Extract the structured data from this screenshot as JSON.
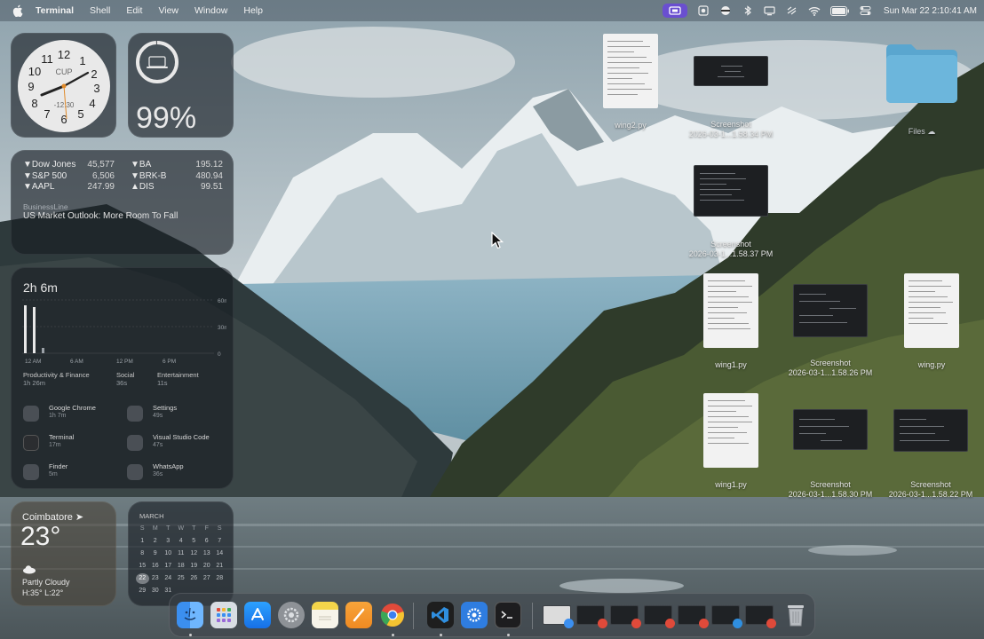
{
  "menubar": {
    "app_name": "Terminal",
    "menus": [
      "Shell",
      "Edit",
      "View",
      "Window",
      "Help"
    ],
    "clock": "Sun Mar 22  2:10:41 AM",
    "icons": [
      "screen-sharing-icon",
      "record-icon",
      "vpn-icon",
      "bluetooth-icon",
      "display-icon",
      "airplay-icon",
      "wifi-icon",
      "battery-icon",
      "control-center-icon"
    ]
  },
  "clock_widget": {
    "label": "CUP",
    "time_text": "-12:30",
    "numbers": [
      "12",
      "1",
      "2",
      "3",
      "4",
      "5",
      "6",
      "7",
      "8",
      "9",
      "10",
      "11"
    ]
  },
  "battery_widget": {
    "percent": "99%",
    "level": 0.99
  },
  "stocks": {
    "left": [
      {
        "name": "▼Dow Jones",
        "value": "45,577"
      },
      {
        "name": "▼S&P 500",
        "value": "6,506"
      },
      {
        "name": "▼AAPL",
        "value": "247.99"
      }
    ],
    "right": [
      {
        "name": "▼BA",
        "value": "195.12"
      },
      {
        "name": "▼BRK-B",
        "value": "480.94"
      },
      {
        "name": "▲DIS",
        "value": "99.51"
      }
    ],
    "source": "BusinessLine",
    "headline": "US Market Outlook: More Room To Fall"
  },
  "screen_time": {
    "total": "2h 6m",
    "y_labels": [
      "60m",
      "30m",
      "0"
    ],
    "x_labels": [
      "12 AM",
      "6 AM",
      "12 PM",
      "6 PM"
    ],
    "bars_minutes": [
      54,
      52,
      6
    ],
    "categories": [
      {
        "name": "Productivity & Finance",
        "time": "1h 26m"
      },
      {
        "name": "Social",
        "time": "36s"
      },
      {
        "name": "Entertainment",
        "time": "11s"
      }
    ],
    "apps": [
      {
        "name": "Google Chrome",
        "time": "1h 7m"
      },
      {
        "name": "Settings",
        "time": "49s"
      },
      {
        "name": "Terminal",
        "time": "17m"
      },
      {
        "name": "Visual Studio Code",
        "time": "47s"
      },
      {
        "name": "Finder",
        "time": "5m"
      },
      {
        "name": "WhatsApp",
        "time": "36s"
      }
    ]
  },
  "weather": {
    "city": "Coimbatore ➤",
    "temp": "23°",
    "condition": "Partly Cloudy",
    "high_low": "H:35° L:22°"
  },
  "calendar": {
    "month": "MARCH",
    "weekdays": [
      "S",
      "M",
      "T",
      "W",
      "T",
      "F",
      "S"
    ],
    "days": [
      "1",
      "2",
      "3",
      "4",
      "5",
      "6",
      "7",
      "8",
      "9",
      "10",
      "11",
      "12",
      "13",
      "14",
      "15",
      "16",
      "17",
      "18",
      "19",
      "20",
      "21",
      "22",
      "23",
      "24",
      "25",
      "26",
      "27",
      "28",
      "29",
      "30",
      "31"
    ],
    "today": "22"
  },
  "desktop": {
    "items": [
      {
        "label": "wing2.py",
        "sub": ""
      },
      {
        "label": "Screenshot",
        "sub": "2026-03-1...1.58.34 PM"
      },
      {
        "label": "Files ☁",
        "sub": ""
      },
      {
        "label": "Screenshot",
        "sub": "2026-03-1...1.58.37 PM"
      },
      {
        "label": "wing1.py",
        "sub": ""
      },
      {
        "label": "Screenshot",
        "sub": "2026-03-1...1.58.26 PM"
      },
      {
        "label": "wing.py",
        "sub": ""
      },
      {
        "label": "wing1.py",
        "sub": ""
      },
      {
        "label": "Screenshot",
        "sub": "2026-03-1...1.58.30 PM"
      },
      {
        "label": "Screenshot",
        "sub": "2026-03-1...1.58.22 PM"
      }
    ]
  },
  "dock": {
    "apps": [
      "finder-icon",
      "launchpad-icon",
      "app-store-icon",
      "system-settings-icon",
      "notes-icon",
      "pages-icon",
      "google-chrome-icon",
      "visual-studio-code-icon",
      "settings-gear-icon",
      "terminal-icon"
    ],
    "colors": {
      "finder": "#3b8ff0",
      "chrome_red": "#e04a3a",
      "vscode": "#2f8fe0",
      "terminal": "#2b2b2b"
    }
  }
}
